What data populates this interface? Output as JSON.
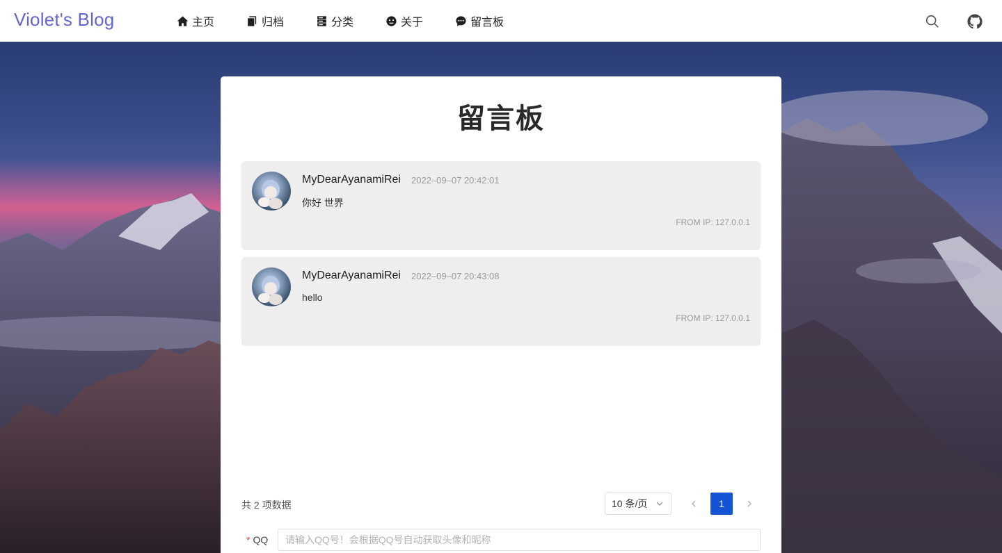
{
  "header": {
    "logo": "Violet's Blog",
    "nav": [
      {
        "label": "主页",
        "icon": "home-icon"
      },
      {
        "label": "归档",
        "icon": "archive-icon"
      },
      {
        "label": "分类",
        "icon": "category-icon"
      },
      {
        "label": "关于",
        "icon": "about-icon"
      },
      {
        "label": "留言板",
        "icon": "message-board-icon"
      }
    ],
    "right_icons": [
      "search-icon",
      "github-icon"
    ]
  },
  "page": {
    "title": "留言板"
  },
  "messages": [
    {
      "name": "MyDearAyanamiRei",
      "time": "2022–09–07 20:42:01",
      "text": "你好 世界",
      "ip": "FROM IP: 127.0.0.1"
    },
    {
      "name": "MyDearAyanamiRei",
      "time": "2022–09–07 20:43:08",
      "text": "hello",
      "ip": "FROM IP: 127.0.0.1"
    }
  ],
  "pagination": {
    "total": "共 2 项数据",
    "page_size": "10 条/页",
    "current": "1"
  },
  "form": {
    "qq_required_mark": "*",
    "qq_label": "QQ",
    "qq_placeholder": "请输入QQ号！会根据QQ号自动获取头像和昵称",
    "qq_value": ""
  },
  "colors": {
    "logo": "#6366d1",
    "primary": "#1453d6",
    "message_bg": "#eeeeee"
  }
}
